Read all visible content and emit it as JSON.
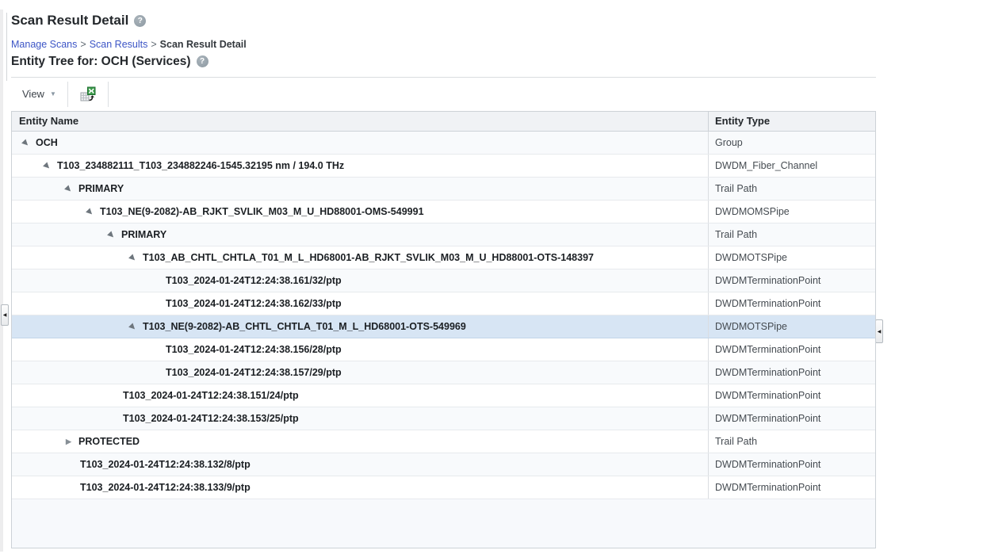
{
  "page": {
    "title": "Scan Result Detail"
  },
  "breadcrumb": {
    "separator": ">",
    "links": [
      {
        "label": "Manage Scans"
      },
      {
        "label": "Scan Results"
      }
    ],
    "current": "Scan Result Detail"
  },
  "section": {
    "heading": "Entity Tree for: OCH (Services)"
  },
  "toolbar": {
    "view_label": "View"
  },
  "icons": {
    "help": "?",
    "caret_down": "▼",
    "tree_expanded": "▶",
    "tree_collapsed": "▶",
    "splitter_left": "◀",
    "splitter_right": "◀",
    "excel_export": "export-to-excel"
  },
  "colors": {
    "selected_row": "#d7e5f4",
    "header_bg": "#f0f2f5",
    "link_blue": "#3c55c6",
    "excel_green": "#3d9b4b"
  },
  "table": {
    "columns": [
      "Entity Name",
      "Entity Type"
    ],
    "rows": [
      {
        "name": "OCH",
        "type": "Group",
        "level": 0,
        "state": "expanded",
        "selected": false
      },
      {
        "name": "T103_234882111_T103_234882246-1545.32195 nm / 194.0 THz",
        "type": "DWDM_Fiber_Channel",
        "level": 1,
        "state": "expanded",
        "selected": false
      },
      {
        "name": "PRIMARY",
        "type": "Trail Path",
        "level": 2,
        "state": "expanded",
        "selected": false
      },
      {
        "name": "T103_NE(9-2082)-AB_RJKT_SVLIK_M03_M_U_HD88001-OMS-549991",
        "type": "DWDMOMSPipe",
        "level": 3,
        "state": "expanded",
        "selected": false
      },
      {
        "name": "PRIMARY",
        "type": "Trail Path",
        "level": 4,
        "state": "expanded",
        "selected": false
      },
      {
        "name": "T103_AB_CHTL_CHTLA_T01_M_L_HD68001-AB_RJKT_SVLIK_M03_M_U_HD88001-OTS-148397",
        "type": "DWDMOTSPipe",
        "level": 5,
        "state": "expanded",
        "selected": false
      },
      {
        "name": "T103_2024-01-24T12:24:38.161/32/ptp",
        "type": "DWDMTerminationPoint",
        "level": 6,
        "state": "leaf",
        "selected": false
      },
      {
        "name": "T103_2024-01-24T12:24:38.162/33/ptp",
        "type": "DWDMTerminationPoint",
        "level": 6,
        "state": "leaf",
        "selected": false
      },
      {
        "name": "T103_NE(9-2082)-AB_CHTL_CHTLA_T01_M_L_HD68001-OTS-549969",
        "type": "DWDMOTSPipe",
        "level": 5,
        "state": "expanded",
        "selected": true
      },
      {
        "name": "T103_2024-01-24T12:24:38.156/28/ptp",
        "type": "DWDMTerminationPoint",
        "level": 6,
        "state": "leaf",
        "selected": false
      },
      {
        "name": "T103_2024-01-24T12:24:38.157/29/ptp",
        "type": "DWDMTerminationPoint",
        "level": 6,
        "state": "leaf",
        "selected": false
      },
      {
        "name": "T103_2024-01-24T12:24:38.151/24/ptp",
        "type": "DWDMTerminationPoint",
        "level": 4,
        "state": "leaf",
        "selected": false
      },
      {
        "name": "T103_2024-01-24T12:24:38.153/25/ptp",
        "type": "DWDMTerminationPoint",
        "level": 4,
        "state": "leaf",
        "selected": false
      },
      {
        "name": "PROTECTED",
        "type": "Trail Path",
        "level": 2,
        "state": "collapsed",
        "selected": false
      },
      {
        "name": "T103_2024-01-24T12:24:38.132/8/ptp",
        "type": "DWDMTerminationPoint",
        "level": 2,
        "state": "leaf",
        "selected": false
      },
      {
        "name": "T103_2024-01-24T12:24:38.133/9/ptp",
        "type": "DWDMTerminationPoint",
        "level": 2,
        "state": "leaf",
        "selected": false
      }
    ]
  }
}
